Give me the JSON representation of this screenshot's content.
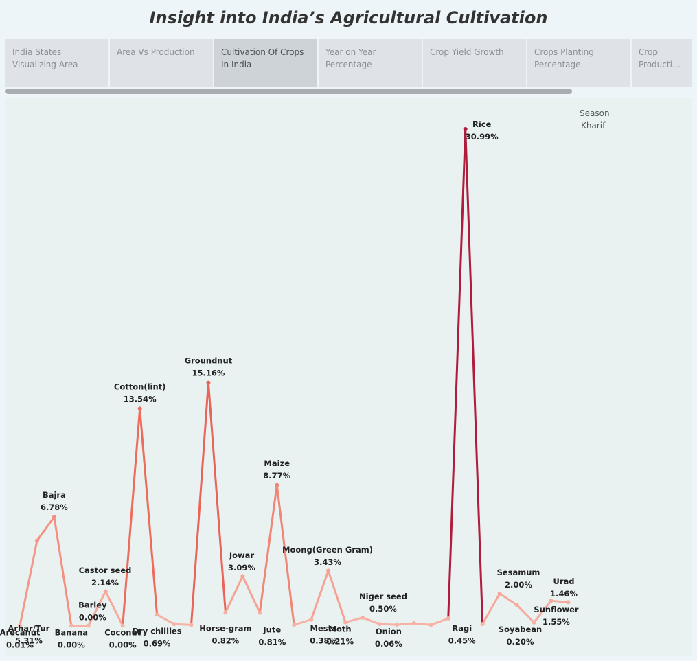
{
  "title": "Insight into India’s Agricultural Cultivation",
  "tabs": [
    {
      "label": "India States Visualizing Area"
    },
    {
      "label": "Area Vs Production"
    },
    {
      "label": "Cultivation Of Crops In India"
    },
    {
      "label": "Year on Year Percentage"
    },
    {
      "label": "Crop Yield Growth"
    },
    {
      "label": "Crops Planting Percentage"
    },
    {
      "label_line1": "Crop",
      "label_line2": "Production I.."
    }
  ],
  "active_tab_index": 2,
  "legend": {
    "title": "Season",
    "value": "Kharif"
  },
  "colors": {
    "low": "#f7b3a6",
    "mid": "#ee6a5a",
    "high": "#b01c3c"
  },
  "chart_data": {
    "type": "line",
    "title": "",
    "xlabel": "",
    "ylabel": "",
    "ylim": [
      0,
      31
    ],
    "grid": false,
    "legend_placement": "top-right",
    "points": [
      {
        "crop": "Arecanut",
        "value": 0.01,
        "label": "0.01%",
        "shown": true
      },
      {
        "crop": "Arhar/Tur",
        "value": 5.31,
        "label": "5.31%",
        "shown": true
      },
      {
        "crop": "Bajra",
        "value": 6.78,
        "label": "6.78%",
        "shown": true
      },
      {
        "crop": "Banana",
        "value": 0.0,
        "label": "0.00%",
        "shown": true
      },
      {
        "crop": "Barley",
        "value": 0.0,
        "label": "0.00%",
        "shown": true
      },
      {
        "crop": "Castor seed",
        "value": 2.14,
        "label": "2.14%",
        "shown": true
      },
      {
        "crop": "Coconut",
        "value": 0.0,
        "label": "0.00%",
        "shown": true
      },
      {
        "crop": "Cotton(lint)",
        "value": 13.54,
        "label": "13.54%",
        "shown": true
      },
      {
        "crop": "Dry chillies",
        "value": 0.69,
        "label": "0.69%",
        "shown": true
      },
      {
        "crop": "",
        "value": 0.1,
        "label": "",
        "shown": false
      },
      {
        "crop": "",
        "value": 0.05,
        "label": "",
        "shown": false
      },
      {
        "crop": "Groundnut",
        "value": 15.16,
        "label": "15.16%",
        "shown": true
      },
      {
        "crop": "Horse-gram",
        "value": 0.82,
        "label": "0.82%",
        "shown": true
      },
      {
        "crop": "Jowar",
        "value": 3.09,
        "label": "3.09%",
        "shown": true
      },
      {
        "crop": "Jute",
        "value": 0.81,
        "label": "0.81%",
        "shown": true
      },
      {
        "crop": "Maize",
        "value": 8.77,
        "label": "8.77%",
        "shown": true
      },
      {
        "crop": "",
        "value": 0.05,
        "label": "",
        "shown": false
      },
      {
        "crop": "Mesta",
        "value": 0.38,
        "label": "0.38%",
        "shown": true
      },
      {
        "crop": "Moong(Green Gram)",
        "value": 3.43,
        "label": "3.43%",
        "shown": true
      },
      {
        "crop": "Moth",
        "value": 0.21,
        "label": "0.21%",
        "shown": true
      },
      {
        "crop": "Niger seed",
        "value": 0.5,
        "label": "0.50%",
        "shown": true
      },
      {
        "crop": "",
        "value": 0.1,
        "label": "",
        "shown": false
      },
      {
        "crop": "Onion",
        "value": 0.06,
        "label": "0.06%",
        "shown": true
      },
      {
        "crop": "",
        "value": 0.15,
        "label": "",
        "shown": false
      },
      {
        "crop": "",
        "value": 0.05,
        "label": "",
        "shown": false
      },
      {
        "crop": "Ragi",
        "value": 0.45,
        "label": "0.45%",
        "shown": true
      },
      {
        "crop": "Rice",
        "value": 30.99,
        "label": "30.99%",
        "shown": true
      },
      {
        "crop": "",
        "value": 0.1,
        "label": "",
        "shown": false
      },
      {
        "crop": "Sesamum",
        "value": 2.0,
        "label": "2.00%",
        "shown": true
      },
      {
        "crop": "",
        "value": 1.3,
        "label": "",
        "shown": false
      },
      {
        "crop": "Soyabean",
        "value": 0.2,
        "label": "0.20%",
        "shown": true
      },
      {
        "crop": "Sunflower",
        "value": 1.55,
        "label": "1.55%",
        "shown": true
      },
      {
        "crop": "Urad",
        "value": 1.46,
        "label": "1.46%",
        "shown": true
      }
    ]
  }
}
